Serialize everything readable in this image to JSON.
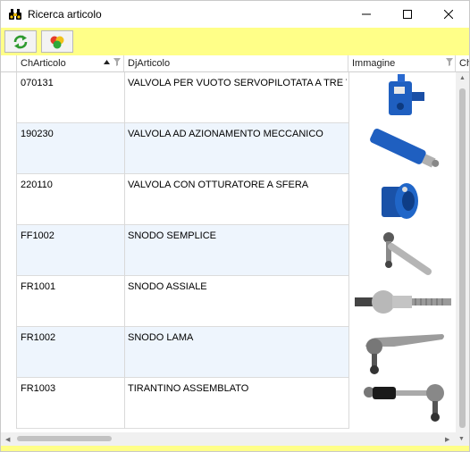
{
  "window": {
    "title": "Ricerca articolo"
  },
  "grid": {
    "columns": [
      {
        "label": "ChArticolo",
        "sorted": "ascending",
        "filter": true
      },
      {
        "label": "DjArticolo",
        "filter": false
      },
      {
        "label": "Immagine",
        "filter": true
      },
      {
        "label": "Ch"
      }
    ],
    "rows": [
      {
        "code": "070131",
        "description": "VALVOLA PER VUOTO SERVOPILOTATA A TRE VIE",
        "image": "blue-solenoid-valve"
      },
      {
        "code": "190230",
        "description": "VALVOLA AD AZIONAMENTO MECCANICO",
        "image": "blue-mechanical-valve"
      },
      {
        "code": "220110",
        "description": "VALVOLA CON OTTURATORE A SFERA",
        "image": "blue-ball-valve"
      },
      {
        "code": "FF1002",
        "description": "SNODO  SEMPLICE",
        "image": "ball-joint"
      },
      {
        "code": "FR1001",
        "description": "SNODO ASSIALE",
        "image": "axial-joint"
      },
      {
        "code": "FR1002",
        "description": "SNODO LAMA",
        "image": "blade-joint"
      },
      {
        "code": "FR1003",
        "description": "TIRANTINO ASSEMBLATO",
        "image": "tie-rod-assembly"
      }
    ]
  },
  "colors": {
    "toolbar_bg": "#ffff88",
    "row_alt_bg": "#eef5fd",
    "grid_line": "#d9d9d9"
  },
  "icons": {
    "app": "binoculars-icon",
    "refresh": "refresh-icon",
    "colors": "color-balls-icon"
  }
}
